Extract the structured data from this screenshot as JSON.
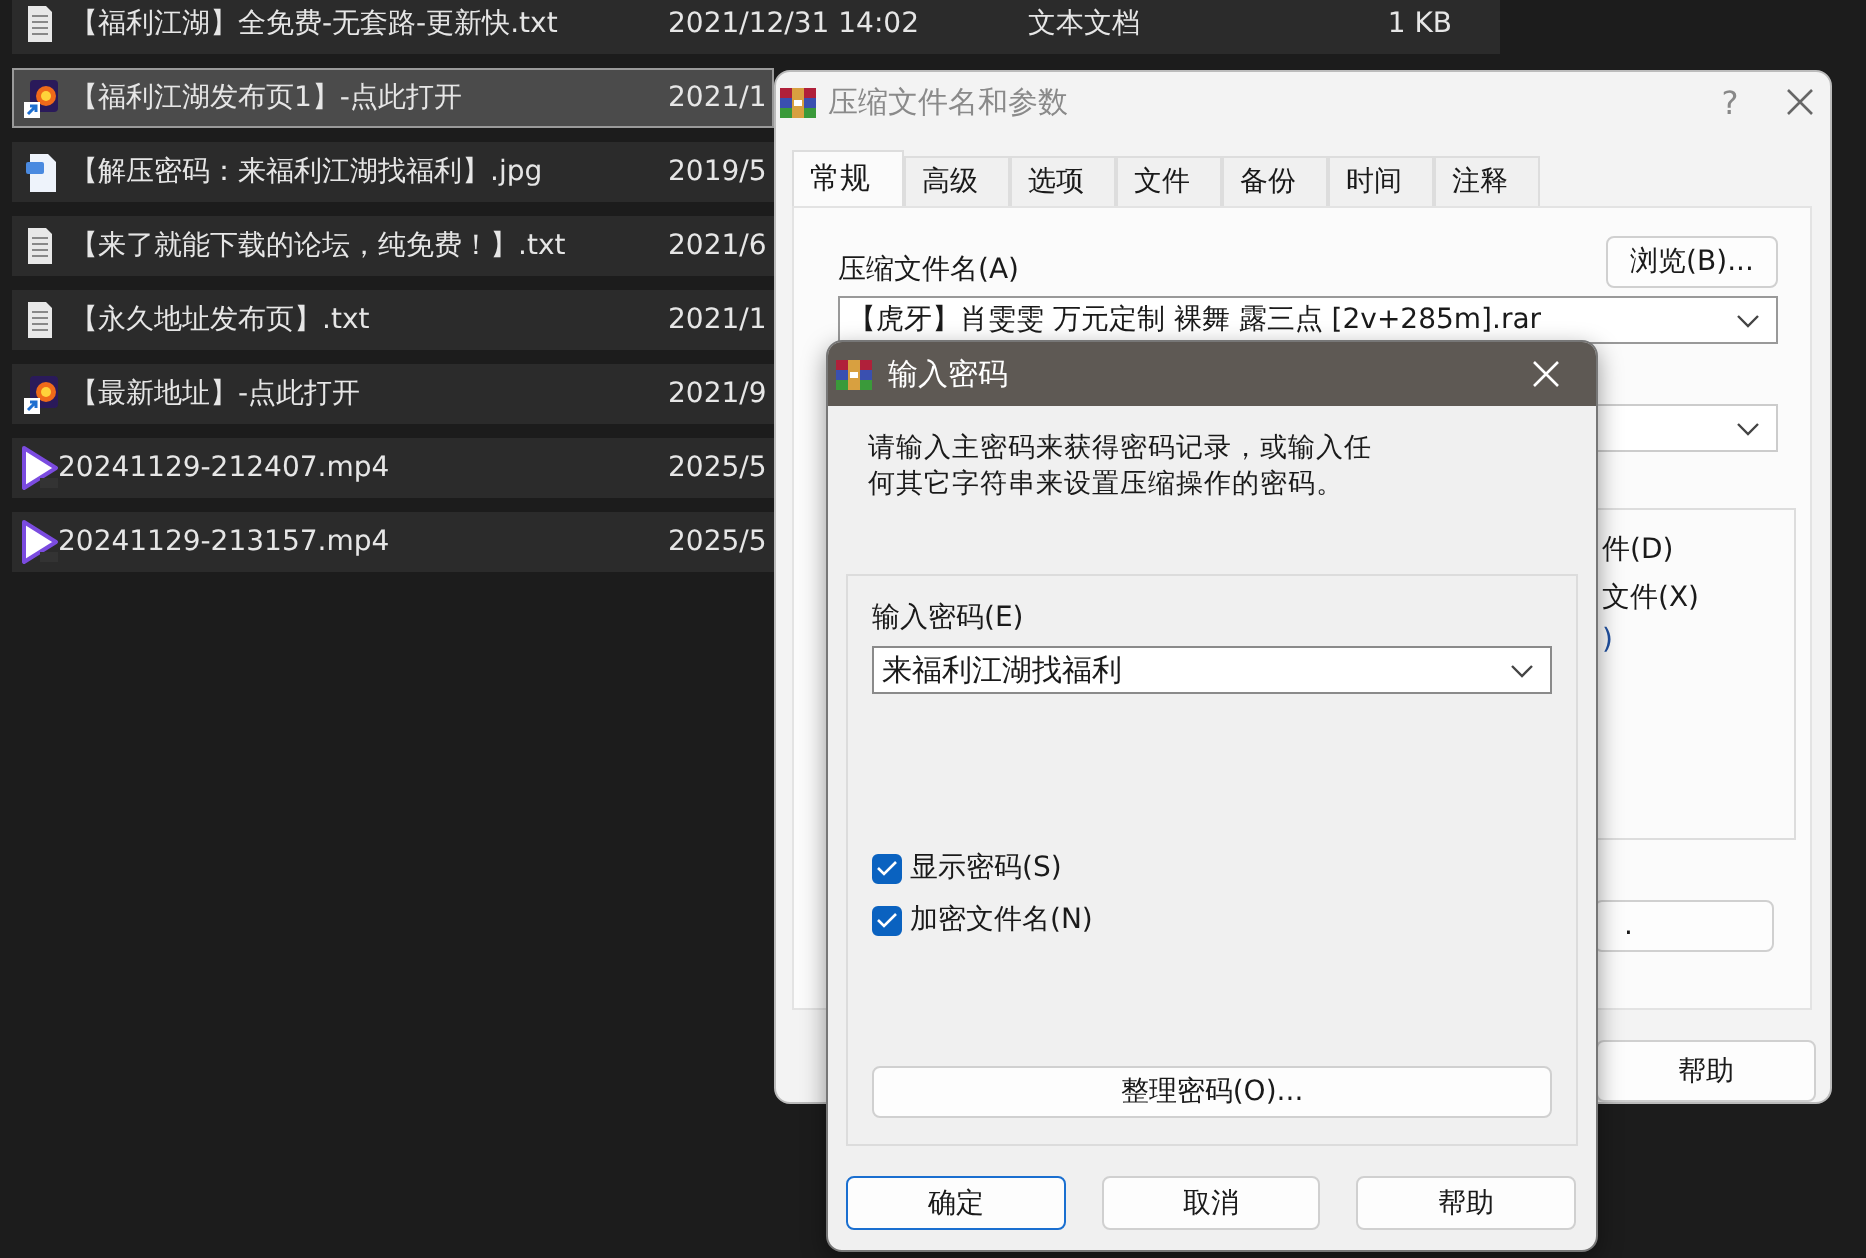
{
  "file_list": {
    "rows": [
      {
        "kind": "text",
        "name": "【福利江湖】全免费-无套路-更新快.txt",
        "date": "2021/12/31 14:02",
        "type": "文本文档",
        "size": "1 KB",
        "selected": false
      },
      {
        "kind": "shortcut",
        "name": "【福利江湖发布页1】-点此打开",
        "date": "2021/1",
        "selected": true
      },
      {
        "kind": "image",
        "name": "【解压密码：来福利江湖找福利】.jpg",
        "date": "2019/5",
        "selected": false
      },
      {
        "kind": "text",
        "name": "【来了就能下载的论坛，纯免费！】.txt",
        "date": "2021/6",
        "selected": false
      },
      {
        "kind": "text",
        "name": "【永久地址发布页】.txt",
        "date": "2021/1",
        "selected": false
      },
      {
        "kind": "shortcut",
        "name": "【最新地址】-点此打开",
        "date": "2021/9",
        "selected": false
      },
      {
        "kind": "video",
        "name": "20241129-212407.mp4",
        "date": "2025/5",
        "selected": false
      },
      {
        "kind": "video",
        "name": "20241129-213157.mp4",
        "date": "2025/5",
        "selected": false
      }
    ]
  },
  "archive_dialog": {
    "title": "压缩文件名和参数",
    "help_symbol": "?",
    "tabs": [
      {
        "label": "常规",
        "selected": true
      },
      {
        "label": "高级",
        "selected": false
      },
      {
        "label": "选项",
        "selected": false
      },
      {
        "label": "文件",
        "selected": false
      },
      {
        "label": "备份",
        "selected": false
      },
      {
        "label": "时间",
        "selected": false
      },
      {
        "label": "注释",
        "selected": false
      }
    ],
    "archive_name_label": "压缩文件名(A)",
    "browse_button": "浏览(B)...",
    "archive_name_value": "【虎牙】肖雯雯 万元定制 裸舞 露三点 [2v+285m].rar",
    "partial_options": [
      "件(D)",
      "文件(X)",
      ")"
    ],
    "partial_button": ".",
    "help_button": "帮助"
  },
  "password_dialog": {
    "title": "输入密码",
    "description": "请输入主密码来获得密码记录，或输入任何其它字符串来设置压缩操作的密码。",
    "password_label": "输入密码(E)",
    "password_value": "来福利江湖找福利",
    "checkboxes": [
      {
        "label": "显示密码(S)",
        "checked": true
      },
      {
        "label": "加密文件名(N)",
        "checked": true
      }
    ],
    "organize_button": "整理密码(O)...",
    "buttons": [
      {
        "label": "确定",
        "default": true
      },
      {
        "label": "取消",
        "default": false
      },
      {
        "label": "帮助",
        "default": false
      }
    ]
  }
}
